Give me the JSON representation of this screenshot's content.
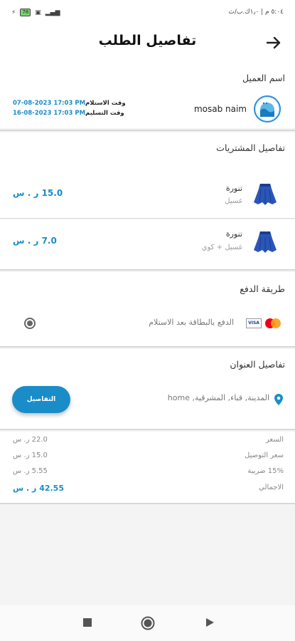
{
  "status_bar": {
    "right_text": "٥:٠٤ م | ١٫٠ك.ب/ث",
    "battery": "78"
  },
  "header": {
    "title": "تفاصيل الطلب"
  },
  "customer": {
    "section_title": "اسم العميل",
    "name": "mosab naim",
    "receipt_label": "وقت الاستلام",
    "receipt_value": "07-08-2023 17:03 PM",
    "delivery_label": "وقت التسليم",
    "delivery_value": "16-08-2023 17:03 PM"
  },
  "purchases": {
    "section_title": "تفاصيل المشتريات",
    "items": [
      {
        "name": "تنورة",
        "service": "غسيل",
        "price": "15.0 ر . س"
      },
      {
        "name": "تنورة",
        "service": "غسيل + كوي",
        "price": "7.0 ر . س"
      }
    ]
  },
  "payment": {
    "section_title": "طريقة الدفع",
    "option_label": "الدفع بالبطاقة بعد الاستلام",
    "visa_text": "VISA"
  },
  "address": {
    "section_title": "تفاصيل العنوان",
    "text": "المدينة, قباء, المشرقية, home",
    "details_button": "التفاصيل"
  },
  "summary": {
    "rows": [
      {
        "label": "السعر",
        "value": "22.0 ر. س"
      },
      {
        "label": "سعر التوصيل",
        "value": "15.0 ر. س"
      },
      {
        "label": "15% ضريبة",
        "value": "5.55 ر. س"
      },
      {
        "label": "الاجمالي",
        "value": "42.55 ر . س"
      }
    ]
  },
  "colors": {
    "accent": "#1a8cc8",
    "skirt": "#2b56b8"
  },
  "icons": [
    "back-arrow-icon",
    "avatar-washing-machine-icon",
    "skirt-icon",
    "mastercard-icon",
    "visa-icon",
    "radio-icon",
    "location-pin-icon",
    "stop-icon",
    "home-icon",
    "back-triangle-icon"
  ]
}
